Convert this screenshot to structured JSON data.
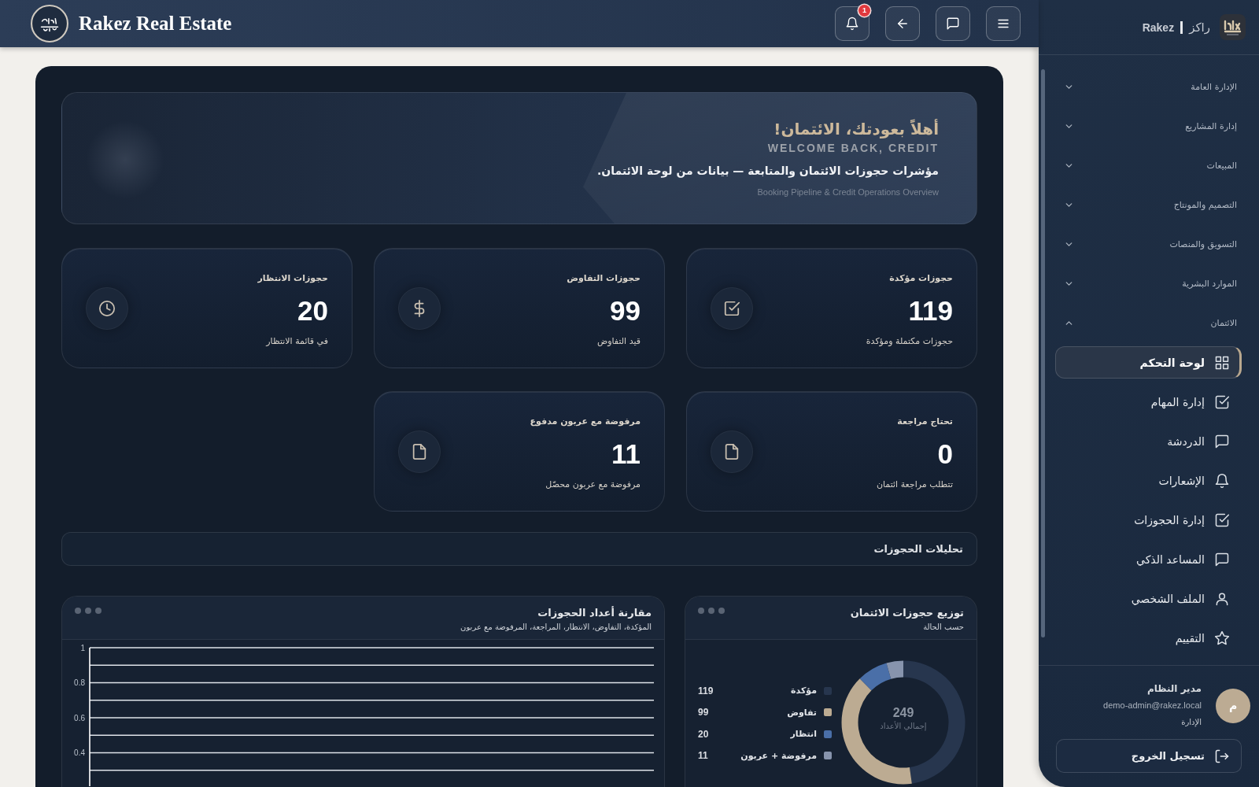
{
  "topbar": {
    "title": "Rakez Real Estate",
    "buttons": [
      {
        "kind": "bell",
        "badge": "1"
      },
      {
        "kind": "back"
      },
      {
        "kind": "chat"
      },
      {
        "kind": "menu"
      }
    ]
  },
  "sidebar": {
    "brand": {
      "name_ar": "راكز",
      "name_en": "Rakez"
    },
    "groups": [
      {
        "label": "الإدارة العامة",
        "expanded": false
      },
      {
        "label": "إدارة المشاريع",
        "expanded": false
      },
      {
        "label": "المبيعات",
        "expanded": false
      },
      {
        "label": "التصميم والمونتاج",
        "expanded": false
      },
      {
        "label": "التسويق والمنصات",
        "expanded": false
      },
      {
        "label": "الموارد البشرية",
        "expanded": false
      },
      {
        "label": "الائتمان",
        "expanded": true,
        "children": [
          {
            "label": "لوحة التحكم",
            "kind": "grid",
            "selected": true
          },
          {
            "label": "إدارة المهام",
            "kind": "check",
            "selected": false
          },
          {
            "label": "الدردشة",
            "kind": "chat",
            "selected": false
          },
          {
            "label": "الإشعارات",
            "kind": "bell",
            "selected": false
          },
          {
            "label": "إدارة الحجوزات",
            "kind": "check",
            "selected": false
          },
          {
            "label": "المساعد الذكي",
            "kind": "chat",
            "selected": false
          },
          {
            "label": "الملف الشخصي",
            "kind": "user",
            "selected": false
          },
          {
            "label": "التقييم",
            "kind": "star",
            "selected": false
          }
        ]
      }
    ],
    "user": {
      "initial": "م",
      "name": "مدير النظام",
      "email": "demo-admin@rakez.local",
      "role": "الإدارة"
    },
    "logout": "تسجيل الخروج"
  },
  "welcome": {
    "title": "أهلاً بعودتك، الائتمان!",
    "subtitle_en": "WELCOME BACK, CREDIT",
    "description": "مؤشرات حجوزات الائتمان والمتابعة — بيانات من لوحة الائتمان.",
    "caption": "Booking Pipeline & Credit Operations Overview"
  },
  "stats": [
    {
      "title": "حجوزات مؤكدة",
      "value": "119",
      "note": "حجوزات مكتملة ومؤكدة",
      "kind": "check"
    },
    {
      "title": "حجوزات التفاوض",
      "value": "99",
      "note": "قيد التفاوض",
      "kind": "dollar"
    },
    {
      "title": "حجوزات الانتظار",
      "value": "20",
      "note": "في قائمة الانتظار",
      "kind": "clock"
    },
    {
      "title": "تحتاج مراجعة",
      "value": "0",
      "note": "تتطلب مراجعة ائتمان",
      "kind": "file"
    },
    {
      "title": "مرفوضة مع عربون مدفوع",
      "value": "11",
      "note": "مرفوضة مع عربون محصّل",
      "kind": "file"
    }
  ],
  "section_title": "تحليلات الحجوزات",
  "charts": {
    "distribution": {
      "title": "توزيع حجوزات الائتمان",
      "subtitle": "حسب الحالة",
      "legend": [
        {
          "color": "#27364e"
        },
        {
          "color": "#bcab92"
        },
        {
          "color": "#4a6fa8"
        },
        {
          "color": "#8794ad"
        }
      ],
      "center_value": "249",
      "center_label": "إجمالي الأعداد",
      "chart_data": {
        "type": "donut",
        "categories": [
          "مؤكدة",
          "تفاوض",
          "انتظار",
          "مرفوضة + عربون"
        ],
        "values": [
          119,
          99,
          20,
          11
        ],
        "value_labels": [
          "119",
          "99",
          "20",
          "11"
        ],
        "legend": "left"
      }
    },
    "comparison": {
      "title": "مقارنة أعداد الحجوزات",
      "subtitle": "المؤكدة، التفاوض، الانتظار، المراجعة، المرفوضة مع عربون",
      "axis_labels": [
        "1",
        "0.8",
        "0.6",
        "0.4"
      ]
    }
  }
}
